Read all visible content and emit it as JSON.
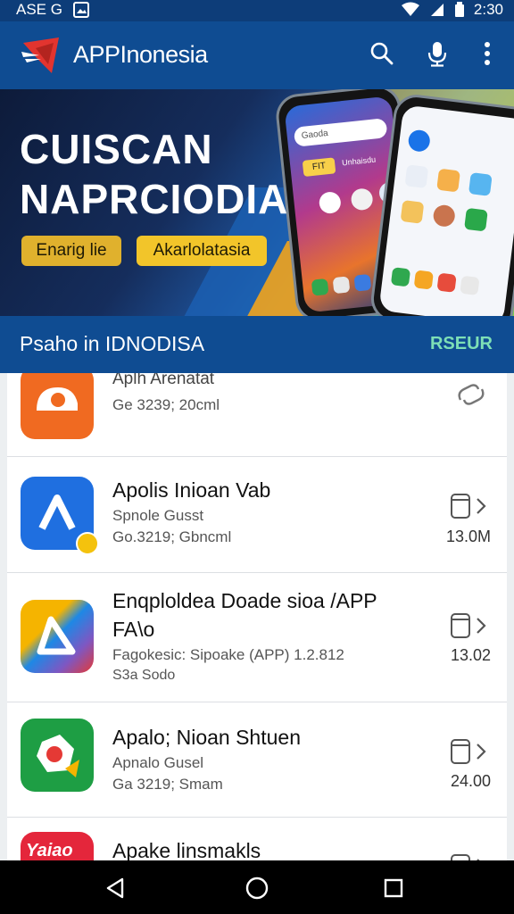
{
  "status": {
    "left_text": "ASE G",
    "time": "2:30"
  },
  "app_bar": {
    "title": "APPInonesia",
    "icons": [
      "search-icon",
      "mic-icon",
      "more-vert-icon"
    ]
  },
  "banner": {
    "title_line1": "CUISCAN",
    "title_line2": "NAPRCIODIA",
    "pill1": "Enarig lie",
    "pill2": "Akarlolatasia",
    "phone_search_text": "Gaoda",
    "phone_badge": "FIT",
    "phone_app_label": "Unhaisdu"
  },
  "section": {
    "title": "Psaho in IDNODISA",
    "action": "RSEUR"
  },
  "apps": [
    {
      "name": "Aplh Arenatat",
      "line1": "Ge 3239; 20cml",
      "line2": "",
      "size": "",
      "icon": "orange-app-icon"
    },
    {
      "name": "Apolis Inioan Vab",
      "line1": "Spnole Gusst",
      "line2": "Go.3219; Gbncml",
      "size": "13.0M",
      "icon": "blue-a-app-icon"
    },
    {
      "name": "Enqploldea Doade sioa /APP",
      "name2": "FA\\o",
      "line1": "Fagokesic: Sipoake (APP) 1.2.812",
      "line2": "S3a Sodo",
      "size": "13.02",
      "icon": "drive-app-icon"
    },
    {
      "name": "Apalo; Nioan Shtuen",
      "line1": "Apnalo Gusel",
      "line2": "Ga 3219; Smam",
      "size": "24.00",
      "icon": "green-app-icon"
    },
    {
      "name": "Apake linsmakls",
      "line1": "",
      "line2": "",
      "size": "",
      "icon": "red-app-icon",
      "icon_text": "Yaiao"
    }
  ],
  "colors": {
    "primary": "#0f4c92",
    "accent": "#f2c52a",
    "section_action": "#7ddfb6"
  }
}
